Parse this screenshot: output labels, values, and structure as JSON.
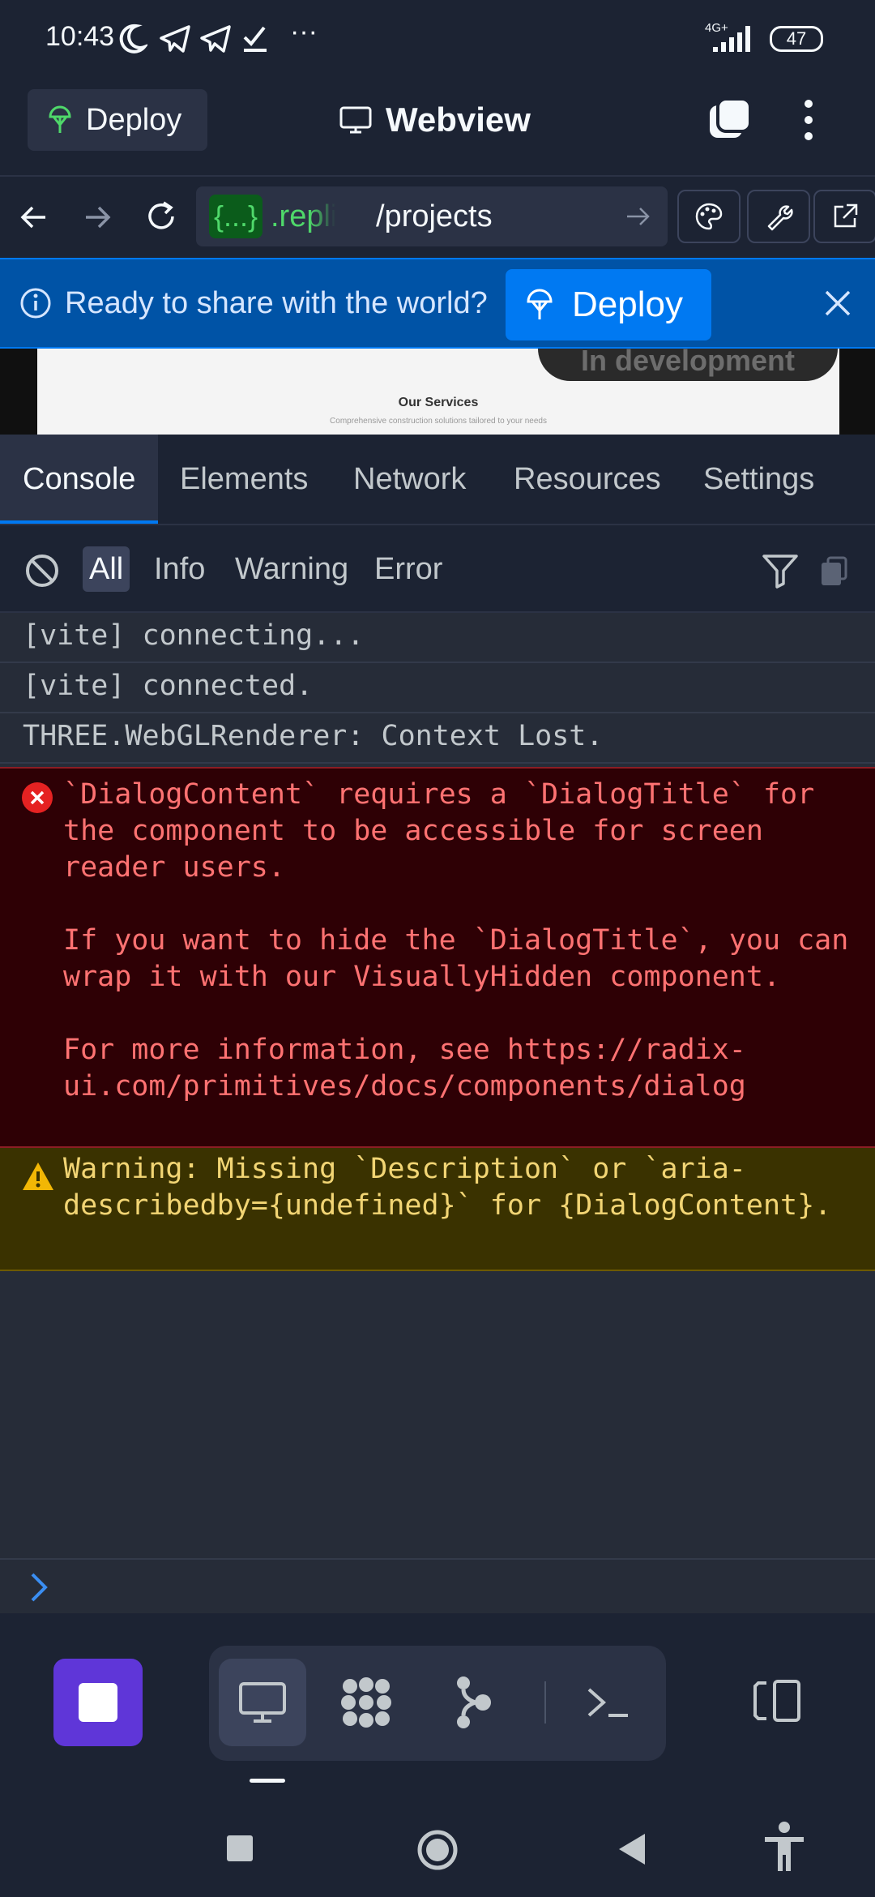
{
  "status_bar": {
    "time": "10:43",
    "network": "4G+",
    "battery": "47",
    "more": "···"
  },
  "app_bar": {
    "deploy_label": "Deploy",
    "title": "Webview"
  },
  "url_bar": {
    "badge": "{...}",
    "domain": ".replit.",
    "path": "/projects"
  },
  "banner": {
    "message": "Ready to share with the world?",
    "deploy_label": "Deploy"
  },
  "preview": {
    "pill_text": "In development",
    "heading": "Our Services",
    "subheading": "Comprehensive construction solutions tailored to your needs"
  },
  "devtools": {
    "tabs": [
      "Console",
      "Elements",
      "Network",
      "Resources",
      "Settings"
    ],
    "active_tab": "Console"
  },
  "filters": {
    "items": [
      "All",
      "Info",
      "Warning",
      "Error"
    ],
    "active": "All"
  },
  "console": {
    "logs": [
      "[vite] connecting...",
      "[vite] connected.",
      "THREE.WebGLRenderer: Context Lost."
    ],
    "error": "`DialogContent` requires a `DialogTitle` for the component to be accessible for screen reader users.\n\nIf you want to hide the `DialogTitle`, you can wrap it with our VisuallyHidden component.\n\nFor more information, see https://radix-ui.com/primitives/docs/components/dialog",
    "warning": "Warning: Missing `Description` or `aria-describedby={undefined}` for {DialogContent}."
  },
  "colors": {
    "background": "#1c2333",
    "accent": "#0079f2",
    "error_text": "#ff7272",
    "warning_text": "#f2d574",
    "stop_button": "#5f36d8"
  }
}
